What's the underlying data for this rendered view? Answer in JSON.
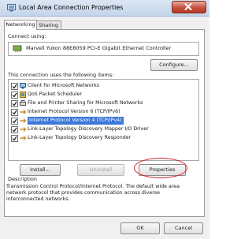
{
  "window": {
    "title": "Local Area Connection Properties"
  },
  "tabs": [
    {
      "label": "Networking",
      "active": true
    },
    {
      "label": "Sharing",
      "active": false
    }
  ],
  "connect_using": {
    "label": "Connect using:",
    "adapter": "Marvell Yukon 88E8059 PCI-E Gigabit Ethernet Controller",
    "configure_label": "Configure..."
  },
  "items_section": {
    "label": "This connection uses the following items:",
    "items": [
      {
        "label": "Client for Microsoft Networks",
        "checked": true,
        "selected": false,
        "icon": "network-client-icon"
      },
      {
        "label": "QoS Packet Scheduler",
        "checked": true,
        "selected": false,
        "icon": "qos-scheduler-icon"
      },
      {
        "label": "File and Printer Sharing for Microsoft Networks",
        "checked": true,
        "selected": false,
        "icon": "printer-sharing-icon"
      },
      {
        "label": "Internet Protocol Version 6 (TCP/IPv6)",
        "checked": true,
        "selected": false,
        "icon": "protocol-icon"
      },
      {
        "label": "Internet Protocol Version 4 (TCP/IPv4)",
        "checked": true,
        "selected": true,
        "icon": "protocol-icon"
      },
      {
        "label": "Link-Layer Topology Discovery Mapper I/O Driver",
        "checked": true,
        "selected": false,
        "icon": "protocol-icon"
      },
      {
        "label": "Link-Layer Topology Discovery Responder",
        "checked": true,
        "selected": false,
        "icon": "protocol-icon"
      }
    ]
  },
  "buttons": {
    "install": "Install...",
    "uninstall": "Uninstall",
    "properties": "Properties",
    "ok": "OK",
    "cancel": "Cancel"
  },
  "description": {
    "label": "Description",
    "text": "Transmission Control Protocol/Internet Protocol. The default wide area network protocol that provides communication across diverse interconnected networks."
  },
  "colors": {
    "selection": "#3c78d8",
    "highlight": "#d32027",
    "close_button": "#c8513e"
  }
}
